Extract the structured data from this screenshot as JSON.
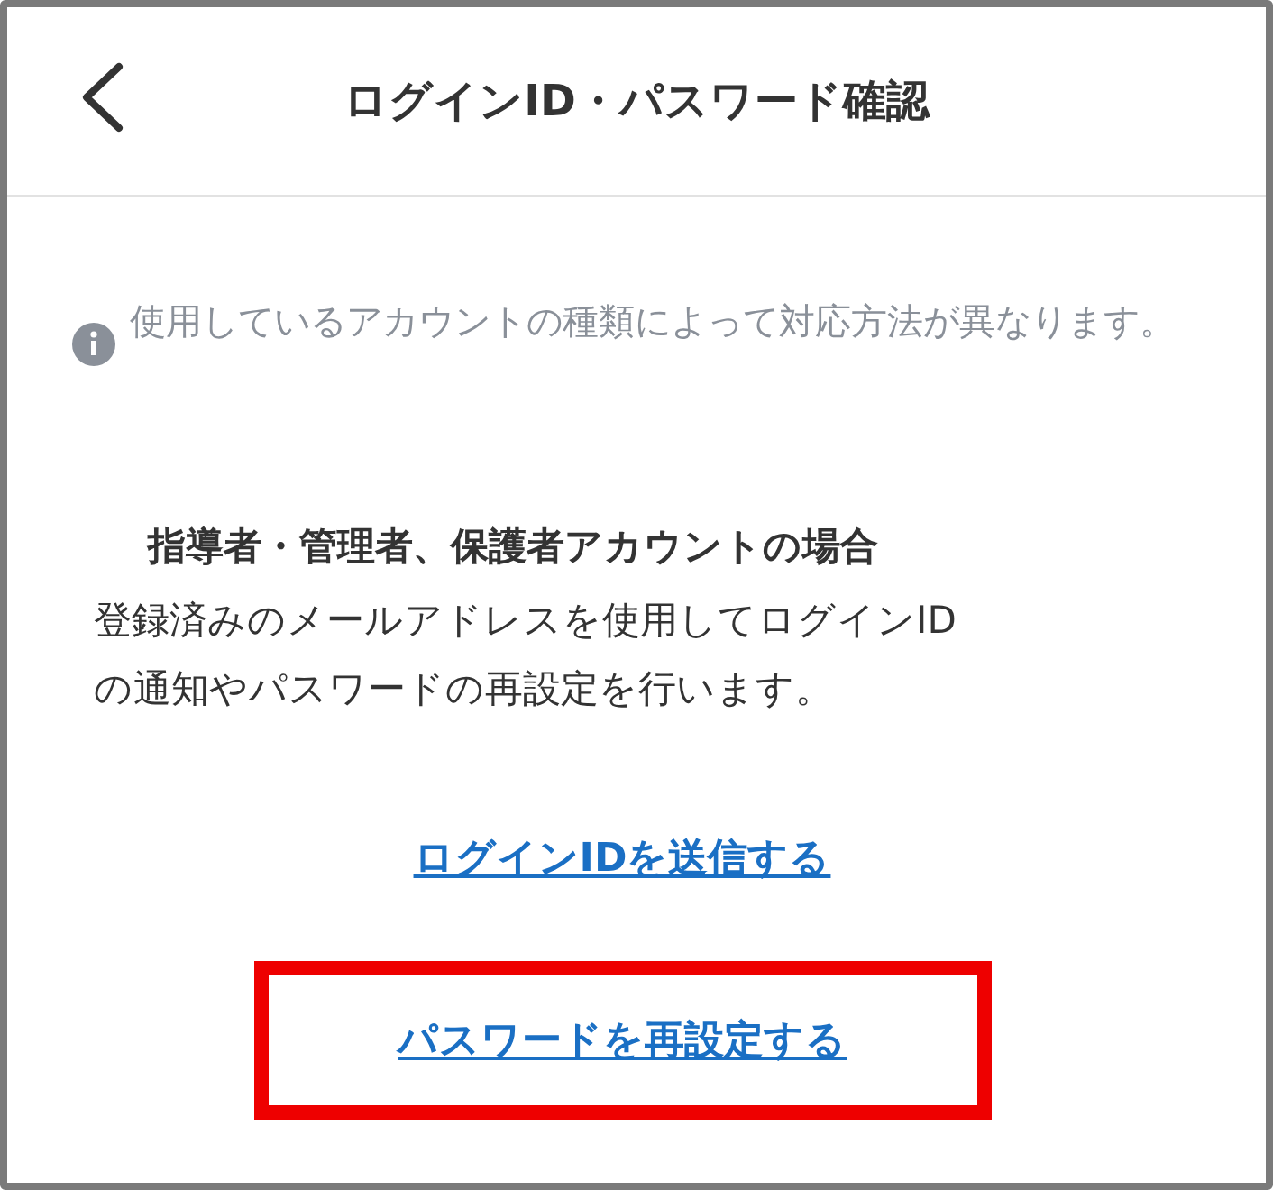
{
  "header": {
    "title": "ログインID・パスワード確認"
  },
  "notice": {
    "text": "使用しているアカウントの種類によって対応方法が異なります。"
  },
  "section": {
    "heading": "指導者・管理者、保護者アカウントの場合",
    "body": "登録済みのメールアドレスを使用してログインIDの通知やパスワードの再設定を行います。"
  },
  "links": [
    {
      "label": "ログインIDを送信する",
      "highlighted": false
    },
    {
      "label": "パスワードを再設定する",
      "highlighted": true
    }
  ]
}
